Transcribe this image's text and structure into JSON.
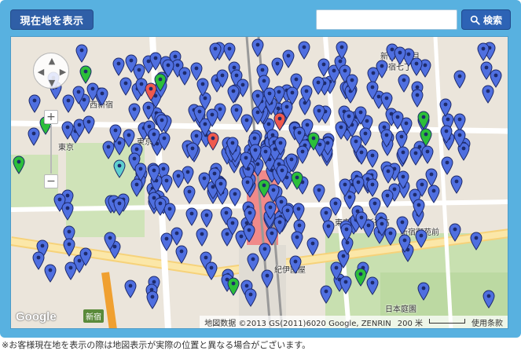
{
  "toolbar": {
    "locate_label": "現在地を表示",
    "search_placeholder": "",
    "search_label": "検索"
  },
  "map": {
    "pan_control": "pan-control",
    "zoom_in": "+",
    "zoom_out": "−",
    "logo": "Google",
    "attribution": "地図数据 ©2013 GS(2011)6020 Google, ZENRIN",
    "scale": "200 米",
    "terms": "使用条款",
    "labels": [
      {
        "id": "nishi-shinjuku-top",
        "text": "西新"
      },
      {
        "id": "nishi-shinjuku",
        "text": "西新宿"
      },
      {
        "id": "higashi-tokyo",
        "text": "東京"
      },
      {
        "id": "shinjuku-6",
        "text": "新宿六丁目"
      },
      {
        "id": "shinjuku-7",
        "text": "新宿七丁目"
      },
      {
        "id": "tokyo-tocho",
        "text": "東京都庁"
      },
      {
        "id": "gyoenmae",
        "text": "新宿御苑前"
      },
      {
        "id": "tokyo-univ",
        "text": "東京都立新宿高"
      },
      {
        "id": "nihon-teien",
        "text": "日本庭園"
      },
      {
        "id": "kioi",
        "text": "紀伊國屋"
      },
      {
        "id": "shinjuku-station-label",
        "text": "新宿"
      }
    ]
  },
  "note": "※お客様現在地を表示の際は地図表示が実際の位置と異なる場合がございます。",
  "colors": {
    "frame": "#58b1e0",
    "button": "#2f5fa7",
    "pin_blue": "#4f6fe0",
    "pin_green": "#2cbf3a",
    "pin_red": "#ef5a4e",
    "pin_cyan": "#5fd0cf"
  }
}
